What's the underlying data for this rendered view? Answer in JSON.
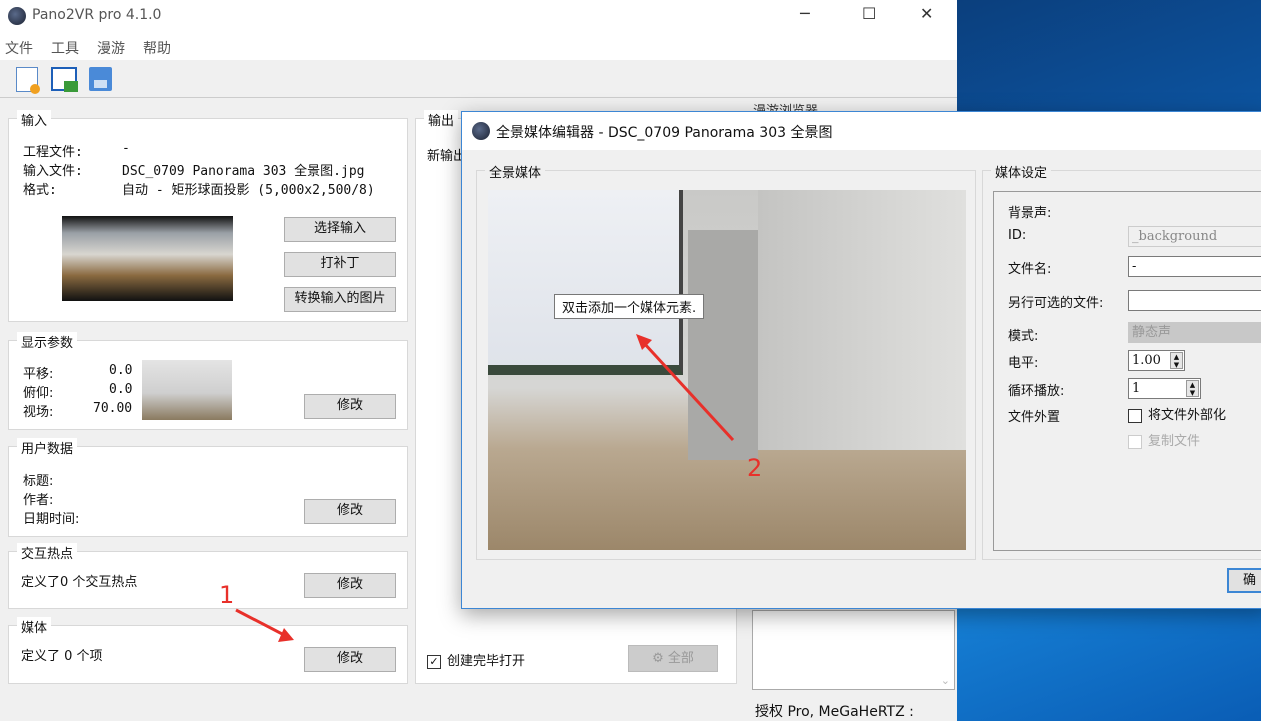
{
  "main_window": {
    "title": "Pano2VR pro 4.1.0",
    "menu": [
      "文件",
      "工具",
      "漫游",
      "帮助"
    ],
    "toolbar": [
      "new-project-icon",
      "open-project-icon",
      "save-icon"
    ],
    "input": {
      "title": "输入",
      "project_label": "工程文件:",
      "project_value": "-",
      "input_label": "输入文件:",
      "input_value": "DSC_0709 Panorama 303 全景图.jpg",
      "format_label": "格式:",
      "format_value": "自动 - 矩形球面投影 (5,000x2,500/8)",
      "buttons": [
        "选择输入",
        "打补丁",
        "转换输入的图片"
      ]
    },
    "display": {
      "title": "显示参数",
      "pan_label": "平移:",
      "pan": "0.0",
      "tilt_label": "俯仰:",
      "tilt": "0.0",
      "fov_label": "视场:",
      "fov": "70.00",
      "edit": "修改"
    },
    "userdata": {
      "title": "用户数据",
      "title_label": "标题:",
      "author_label": "作者:",
      "date_label": "日期时间:",
      "edit": "修改"
    },
    "hotspots": {
      "title": "交互热点",
      "text": "定义了0 个交互热点",
      "edit": "修改"
    },
    "media": {
      "title": "媒体",
      "text": "定义了 0 个项",
      "edit": "修改"
    },
    "output": {
      "title": "输出",
      "new_output": "新输出",
      "open_after": "创建完毕打开",
      "open_after_checked": true,
      "build_all": "全部"
    },
    "tour_browser": {
      "title": "漫游浏览器"
    },
    "status": "授权 Pro, MeGaHeRTZ :"
  },
  "dialog": {
    "title": "全景媒体编辑器 - DSC_0709 Panorama 303 全景图",
    "media_group": "全景媒体",
    "tooltip": "双击添加一个媒体元素.",
    "settings_group": "媒体设定",
    "bg_sound": "背景声:",
    "id_label": "ID:",
    "id_value": "_background",
    "file_label": "文件名:",
    "file_value": "-",
    "alt_label": "另行可选的文件:",
    "alt_value": "",
    "mode_label": "模式:",
    "mode_value": "静态声",
    "level_label": "电平:",
    "level_value": "1.00",
    "loop_label": "循环播放:",
    "loop_value": "1",
    "external_label": "文件外置",
    "externalize": "将文件外部化",
    "externalize_checked": false,
    "copy_file": "复制文件",
    "copy_checked": false,
    "ok_partial": "确"
  },
  "annotations": {
    "one": "1",
    "two": "2",
    "color": "#e8302a"
  }
}
